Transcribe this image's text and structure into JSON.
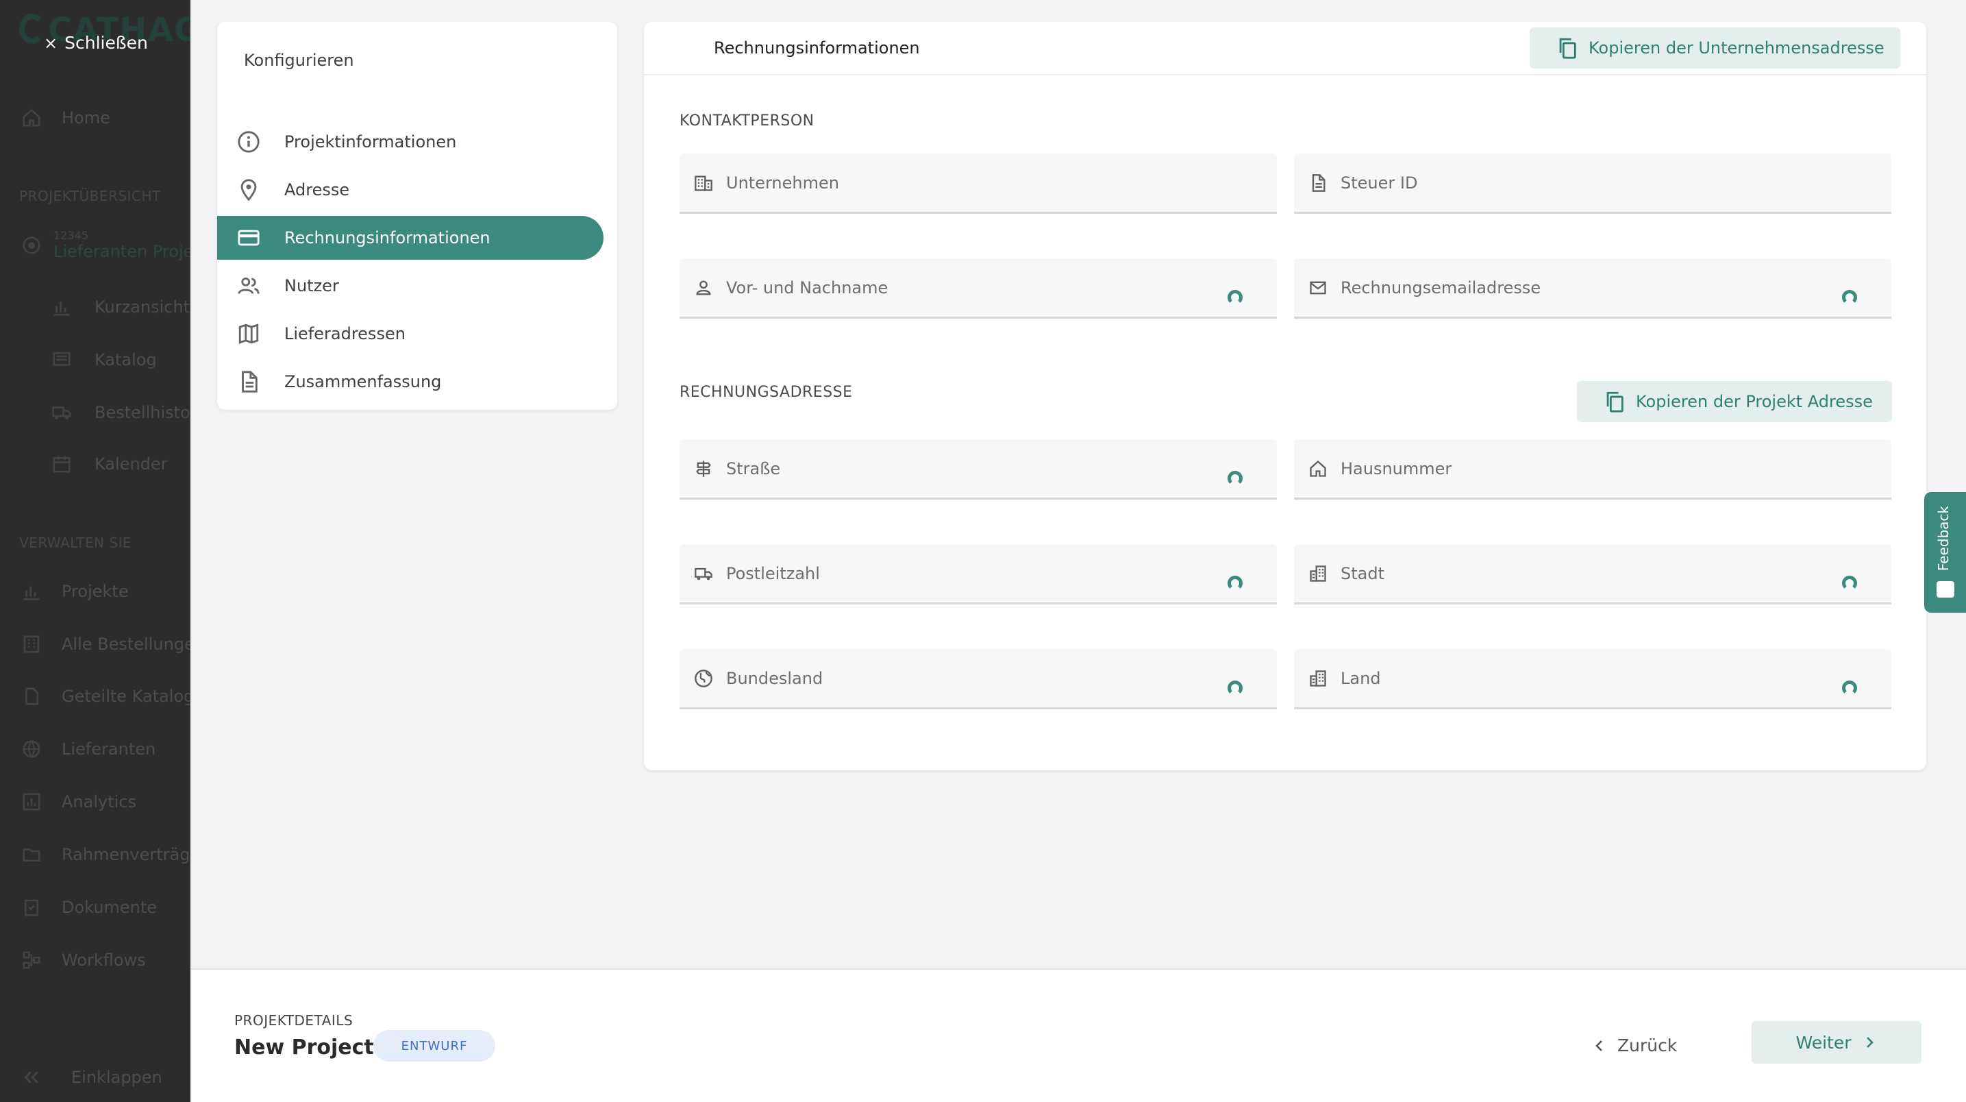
{
  "sidebar": {
    "logo": "CATHAG",
    "close_label": "Schließen",
    "home": "Home",
    "section_project": "PROJEKTÜBERSICHT",
    "project_id": "12345",
    "project_name": "Lieferanten Proje",
    "project_items": [
      "Kurzansicht",
      "Katalog",
      "Bestellhistor",
      "Kalender"
    ],
    "section_manage": "VERWALTEN SIE",
    "manage_items": [
      "Projekte",
      "Alle Bestellunge",
      "Geteilte Kataloge",
      "Lieferanten",
      "Analytics",
      "Rahmenverträge",
      "Dokumente",
      "Workflows"
    ],
    "collapse": "Einklappen"
  },
  "config": {
    "title": "Konfigurieren",
    "items": [
      {
        "label": "Projektinformationen",
        "icon": "info-icon"
      },
      {
        "label": "Adresse",
        "icon": "location-pin-icon"
      },
      {
        "label": "Rechnungsinformationen",
        "icon": "credit-card-icon",
        "active": true
      },
      {
        "label": "Nutzer",
        "icon": "users-icon"
      },
      {
        "label": "Lieferadressen",
        "icon": "map-icon"
      },
      {
        "label": "Zusammenfassung",
        "icon": "document-icon"
      }
    ]
  },
  "form": {
    "header_title": "Rechnungsinformationen",
    "copy_company_label": "Kopieren der Unternehmensadresse",
    "contact_section": "KONTAKTPERSON",
    "billing_section": "RECHNUNGSADRESSE",
    "copy_project_label": "Kopieren der Projekt Adresse",
    "fields": {
      "company": "Unternehmen",
      "tax_id": "Steuer ID",
      "name": "Vor- und Nachname",
      "billing_email": "Rechnungsemailadresse",
      "street": "Straße",
      "house_number": "Hausnummer",
      "postal_code": "Postleitzahl",
      "city": "Stadt",
      "state": "Bundesland",
      "country": "Land"
    }
  },
  "feedback_label": "Feedback",
  "footer": {
    "overline": "PROJEKTDETAILS",
    "title": "New Project",
    "badge": "ENTWURF",
    "back_label": "Zurück",
    "next_label": "Weiter"
  },
  "colors": {
    "accent": "#3c8a7d",
    "accent_light": "#e4efed",
    "badge_bg": "#e5edfb",
    "badge_text": "#3f6ec9",
    "sidebar_bg": "#2c2c2c"
  }
}
